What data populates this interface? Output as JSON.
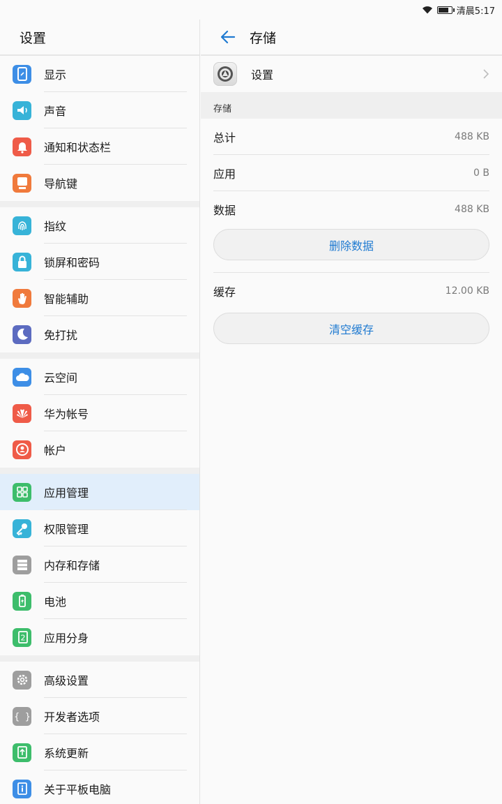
{
  "status_bar": {
    "time": "清晨5:17",
    "battery_level": 0.8
  },
  "left_pane": {
    "title": "设置",
    "groups": [
      {
        "items": [
          {
            "label": "显示",
            "icon": "display-icon",
            "color": "#3d8ee6"
          },
          {
            "label": "声音",
            "icon": "sound-icon",
            "color": "#37b3d8"
          },
          {
            "label": "通知和状态栏",
            "icon": "notification-bell-icon",
            "color": "#ef5b48"
          },
          {
            "label": "导航键",
            "icon": "navigation-key-icon",
            "color": "#f07a3c"
          }
        ]
      },
      {
        "items": [
          {
            "label": "指纹",
            "icon": "fingerprint-icon",
            "color": "#37b3d8"
          },
          {
            "label": "锁屏和密码",
            "icon": "lock-icon",
            "color": "#37b3d8"
          },
          {
            "label": "智能辅助",
            "icon": "hand-icon",
            "color": "#f07a3c"
          },
          {
            "label": "免打扰",
            "icon": "moon-icon",
            "color": "#5c6bc0"
          }
        ]
      },
      {
        "items": [
          {
            "label": "云空间",
            "icon": "cloud-icon",
            "color": "#3d8ee6"
          },
          {
            "label": "华为帐号",
            "icon": "huawei-icon",
            "color": "#ef5b48"
          },
          {
            "label": "帐户",
            "icon": "account-icon",
            "color": "#ef5b48"
          }
        ]
      },
      {
        "items": [
          {
            "label": "应用管理",
            "icon": "apps-grid-icon",
            "color": "#3dbd6b",
            "selected": true
          },
          {
            "label": "权限管理",
            "icon": "key-icon",
            "color": "#37b3d8"
          },
          {
            "label": "内存和存储",
            "icon": "storage-icon",
            "color": "#9e9e9e"
          },
          {
            "label": "电池",
            "icon": "battery-icon",
            "color": "#3dbd6b"
          },
          {
            "label": "应用分身",
            "icon": "app-twin-icon",
            "color": "#3dbd6b"
          }
        ]
      },
      {
        "items": [
          {
            "label": "高级设置",
            "icon": "gear-icon",
            "color": "#9e9e9e"
          },
          {
            "label": "开发者选项",
            "icon": "braces-icon",
            "color": "#9e9e9e"
          },
          {
            "label": "系统更新",
            "icon": "system-update-icon",
            "color": "#3dbd6b"
          },
          {
            "label": "关于平板电脑",
            "icon": "info-icon",
            "color": "#3d8ee6"
          }
        ]
      }
    ]
  },
  "right_pane": {
    "title": "存储",
    "app_name": "设置",
    "section_label": "存储",
    "total_label": "总计",
    "total_value": "488 KB",
    "app_label": "应用",
    "app_value": "0 B",
    "data_label": "数据",
    "data_value": "488 KB",
    "clear_data_button": "删除数据",
    "cache_label": "缓存",
    "cache_value": "12.00 KB",
    "clear_cache_button": "清空缓存",
    "accent_color": "#1f7ad1"
  }
}
